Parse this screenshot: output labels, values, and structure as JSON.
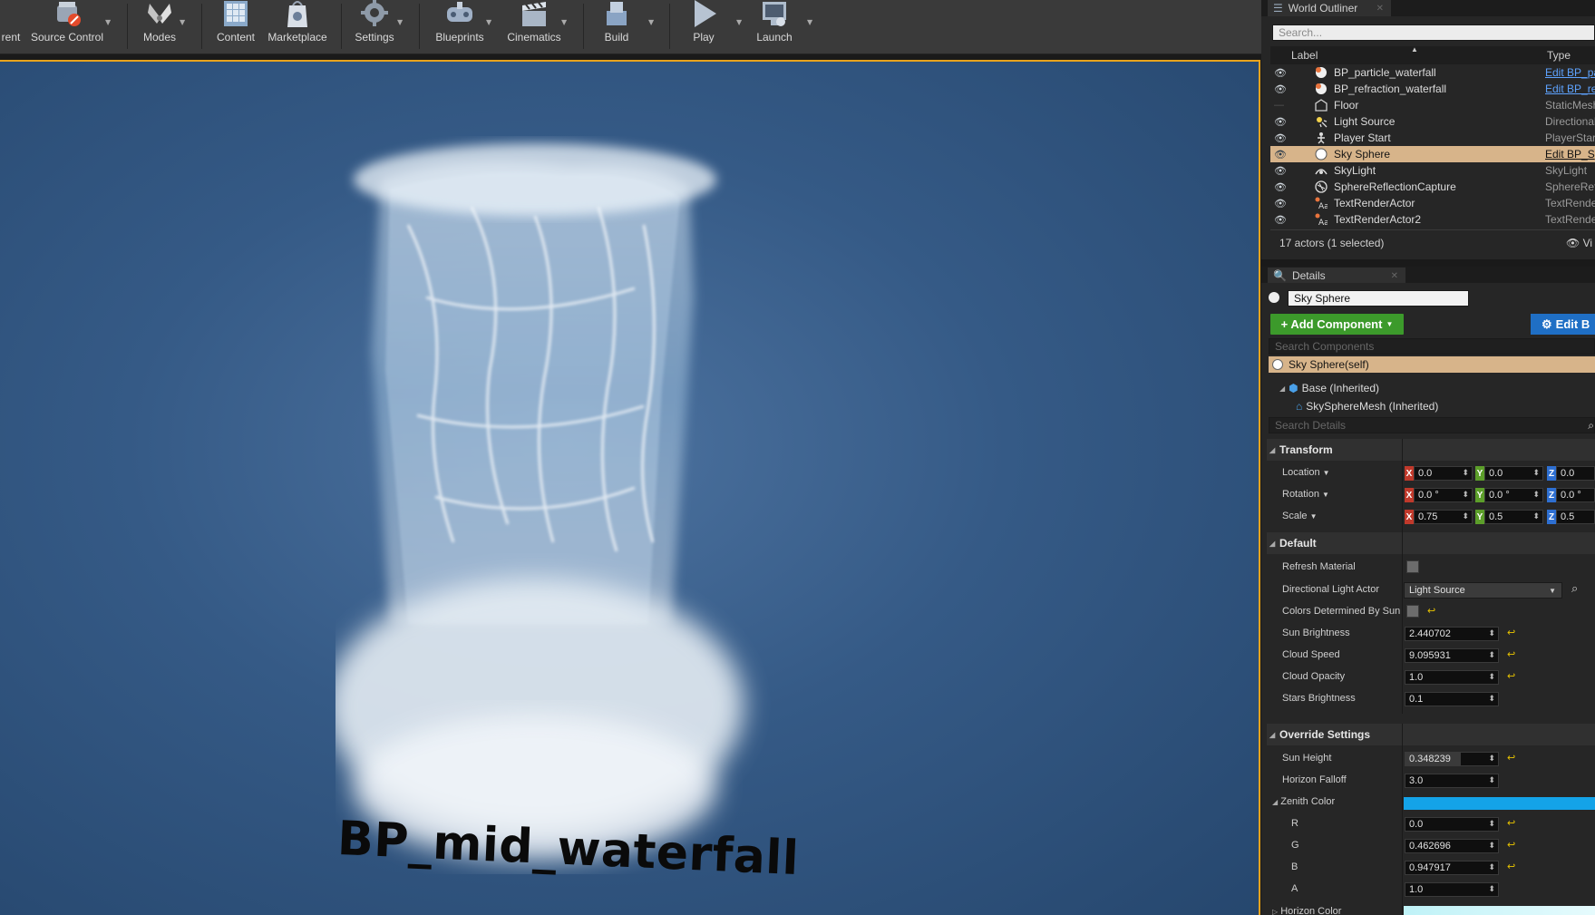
{
  "toolbar": {
    "items": [
      {
        "label": "rent"
      },
      {
        "label": "Source Control"
      },
      {
        "label": "Modes"
      },
      {
        "label": "Content"
      },
      {
        "label": "Marketplace"
      },
      {
        "label": "Settings"
      },
      {
        "label": "Blueprints"
      },
      {
        "label": "Cinematics"
      },
      {
        "label": "Build"
      },
      {
        "label": "Play"
      },
      {
        "label": "Launch"
      }
    ]
  },
  "viewport": {
    "text_actor_label": "BP_mid_waterfall"
  },
  "outliner": {
    "tab_title": "World Outliner",
    "search_placeholder": "Search...",
    "col_label": "Label",
    "col_type": "Type",
    "rows": [
      {
        "label": "BP_particle_waterfall",
        "type": "Edit BP_pa",
        "link": true
      },
      {
        "label": "BP_refraction_waterfall",
        "type": "Edit BP_re",
        "link": true
      },
      {
        "label": "Floor",
        "type": "StaticMesh",
        "link": false
      },
      {
        "label": "Light Source",
        "type": "Directional",
        "link": false
      },
      {
        "label": "Player Start",
        "type": "PlayerStar",
        "link": false
      },
      {
        "label": "Sky Sphere",
        "type": "Edit BP_S",
        "link": true,
        "selected": true
      },
      {
        "label": "SkyLight",
        "type": "SkyLight",
        "link": false
      },
      {
        "label": "SphereReflectionCapture",
        "type": "SphereRefl",
        "link": false
      },
      {
        "label": "TextRenderActor",
        "type": "TextRende",
        "link": false
      },
      {
        "label": "TextRenderActor2",
        "type": "TextRende",
        "link": false
      }
    ],
    "footer": "17 actors (1 selected)",
    "view_label": "Vi"
  },
  "details": {
    "tab_title": "Details",
    "object_name": "Sky Sphere",
    "add_component": "+ Add Component",
    "edit_blueprint": "Edit B",
    "search_components_placeholder": "Search Components",
    "components": [
      {
        "label": "Sky Sphere(self)"
      },
      {
        "label": "Base (Inherited)"
      },
      {
        "label": "SkySphereMesh (Inherited)"
      }
    ],
    "search_details_placeholder": "Search Details",
    "transform": {
      "title": "Transform",
      "location_label": "Location",
      "rotation_label": "Rotation",
      "scale_label": "Scale",
      "location": {
        "x": "0.0",
        "y": "0.0",
        "z": "0.0"
      },
      "rotation": {
        "x": "0.0 °",
        "y": "0.0 °",
        "z": "0.0 °"
      },
      "scale": {
        "x": "0.75",
        "y": "0.5",
        "z": "0.5"
      }
    },
    "default": {
      "title": "Default",
      "refresh_material": "Refresh Material",
      "directional_light_actor": "Directional Light Actor",
      "directional_light_value": "Light Source",
      "colors_by_sun": "Colors Determined By Sun",
      "sun_brightness": "Sun Brightness",
      "sun_brightness_value": "2.440702",
      "cloud_speed": "Cloud Speed",
      "cloud_speed_value": "9.095931",
      "cloud_opacity": "Cloud Opacity",
      "cloud_opacity_value": "1.0",
      "stars_brightness": "Stars Brightness",
      "stars_brightness_value": "0.1"
    },
    "override": {
      "title": "Override Settings",
      "sun_height": "Sun Height",
      "sun_height_value": "0.348239",
      "horizon_falloff": "Horizon Falloff",
      "horizon_falloff_value": "3.0",
      "zenith_color": "Zenith Color",
      "zenith_hex": "#14a3e8",
      "r_label": "R",
      "r_value": "0.0",
      "g_label": "G",
      "g_value": "0.462696",
      "b_label": "B",
      "b_value": "0.947917",
      "a_label": "A",
      "a_value": "1.0",
      "horizon_color": "Horizon Color",
      "horizon_hex": "#bff2f7"
    }
  },
  "colors": {
    "selection": "#d7b48a",
    "viewport_border": "#e8a31c",
    "add_component_green": "#3c9a2b",
    "edit_blue": "#1f6fc5"
  }
}
